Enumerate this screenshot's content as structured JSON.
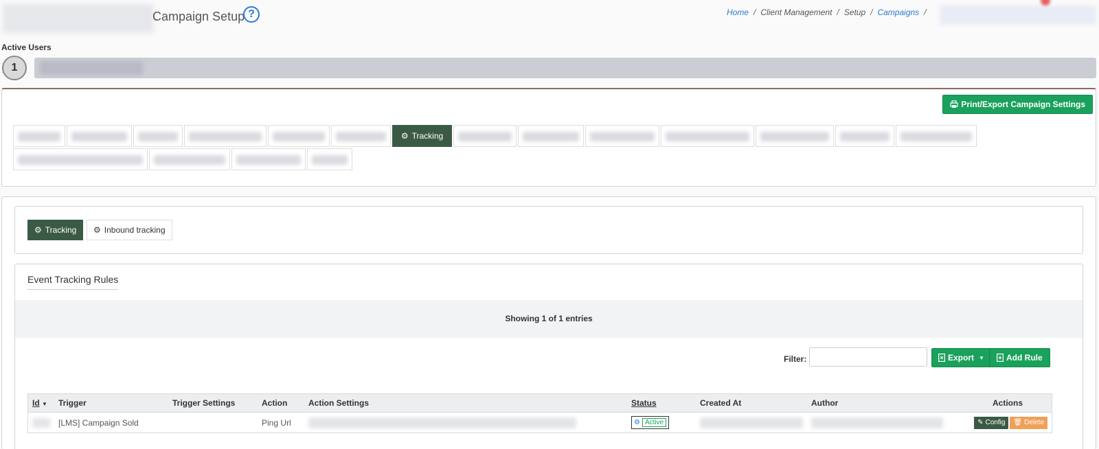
{
  "header": {
    "title": "Campaign Setup",
    "help_glyph": "?",
    "breadcrumb": [
      "Home",
      "Client Management",
      "Setup",
      "Campaigns"
    ],
    "breadcrumb_sep": "/"
  },
  "active_users": {
    "label": "Active Users",
    "count": "1"
  },
  "settings": {
    "print_label": "Print/Export Campaign Settings",
    "active_tab_label": "Tracking"
  },
  "subtabs": {
    "tracking": "Tracking",
    "inbound": "Inbound tracking"
  },
  "rules": {
    "title": "Event Tracking Rules",
    "showing": "Showing 1 of 1 entries",
    "filter_label": "Filter:",
    "export_label": "Export",
    "add_rule_label": "Add Rule"
  },
  "table": {
    "headers": {
      "id": "Id",
      "trigger": "Trigger",
      "trigger_settings": "Trigger Settings",
      "action": "Action",
      "action_settings": "Action Settings",
      "status": "Status",
      "created_at": "Created At",
      "author": "Author",
      "actions": "Actions"
    },
    "rows": [
      {
        "trigger": "[LMS] Campaign Sold",
        "action": "Ping Url",
        "status": "Active",
        "config_label": "Config",
        "delete_label": "Delete"
      }
    ]
  },
  "colors": {
    "accent_green": "#1aa15c",
    "tab_dark": "#3b5a45",
    "link_blue": "#2a7bd0",
    "delete_orange": "#f0a058"
  }
}
